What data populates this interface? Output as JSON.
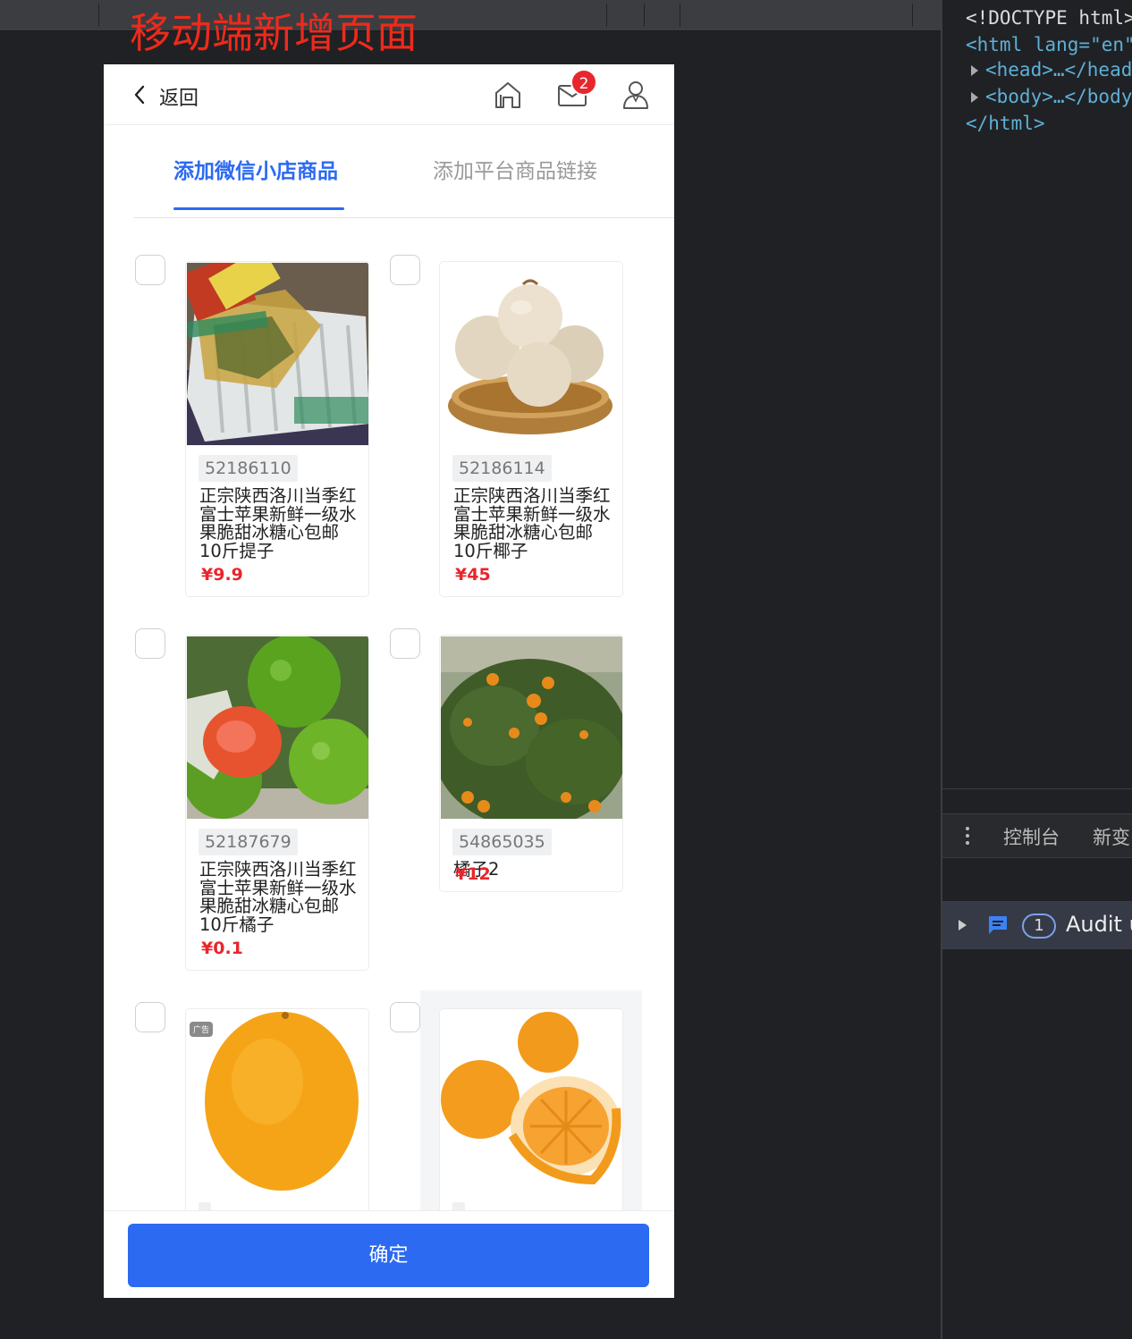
{
  "annotation": {
    "title": "移动端新增页面",
    "color": "#ee2a1b"
  },
  "nav": {
    "back_label": "返回",
    "home_icon": "home-icon",
    "message_icon": "mail-icon",
    "message_badge": "2",
    "user_icon": "user-icon"
  },
  "tabs": [
    {
      "label": "添加微信小店商品",
      "active": true
    },
    {
      "label": "添加平台商品链接",
      "active": false
    }
  ],
  "products": [
    {
      "id": "52186110",
      "name": "正宗陕西洛川当季红富士苹果新鲜一级水果脆甜冰糖心包邮10斤提子",
      "price": "¥9.9",
      "image": "grape-crate-photo"
    },
    {
      "id": "52186114",
      "name": "正宗陕西洛川当季红富士苹果新鲜一级水果脆甜冰糖心包邮10斤椰子",
      "price": "¥45",
      "image": "coconut-basket-photo"
    },
    {
      "id": "52187679",
      "name": "正宗陕西洛川当季红富士苹果新鲜一级水果脆甜冰糖心包邮10斤橘子",
      "price": "¥0.1",
      "image": "green-tangerine-photo"
    },
    {
      "id": "54865035",
      "name": "橘子2",
      "price": "¥12",
      "image": "orange-tree-photo"
    },
    {
      "id": "",
      "name": "",
      "price": "",
      "image": "orange-photo",
      "tag": "广告"
    },
    {
      "id": "",
      "name": "",
      "price": "",
      "image": "peeled-orange-photo"
    }
  ],
  "footer": {
    "confirm_label": "确定"
  },
  "accent_color": "#2b6af1",
  "price_color": "#e8262c",
  "devtools": {
    "doctype_line": "<!DOCTYPE html>",
    "html_open": "<html lang=\"en\">",
    "head_line": "<head>…</head>",
    "body_line": "<body>…</body>",
    "html_close": "</html>",
    "drawer_tabs": [
      "控制台",
      "新变"
    ],
    "issues_count": "1",
    "issues_text": "Audit u"
  }
}
